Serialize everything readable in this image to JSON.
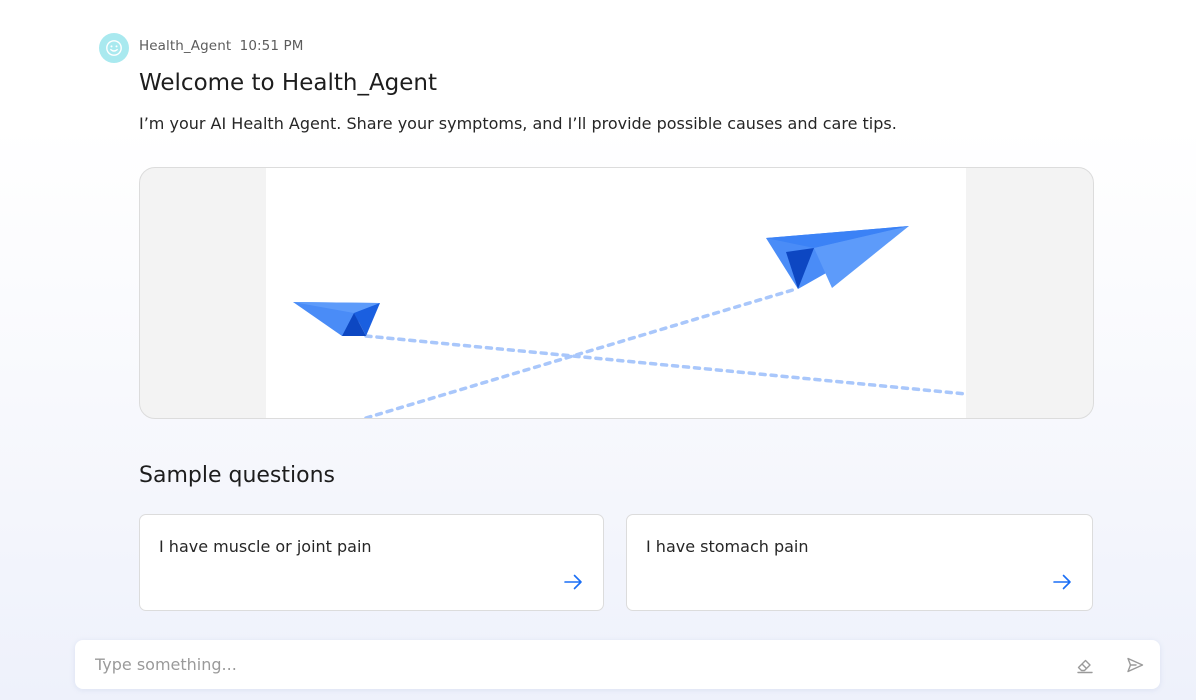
{
  "message": {
    "avatar_icon": "smiley-icon",
    "agent_name": "Health_Agent",
    "time": "10:51 PM",
    "title": "Welcome to Health_Agent",
    "intro": "I’m your AI Health Agent. Share your symptoms, and I’ll provide possible causes and care tips."
  },
  "media": {
    "illustration": "paper-planes-animation",
    "plane_color": "#4a8cf7",
    "trail_color": "#a9c7fb"
  },
  "sample_questions": {
    "title": "Sample questions",
    "items": [
      {
        "text": "I have muscle or joint pain",
        "icon": "arrow-right-icon"
      },
      {
        "text": "I have stomach pain",
        "icon": "arrow-right-icon"
      }
    ]
  },
  "composer": {
    "placeholder": "Type something...",
    "clear_icon": "eraser-icon",
    "send_icon": "send-icon"
  },
  "colors": {
    "accent": "#1a6ef5",
    "avatar_bg": "#a9e9ef"
  }
}
